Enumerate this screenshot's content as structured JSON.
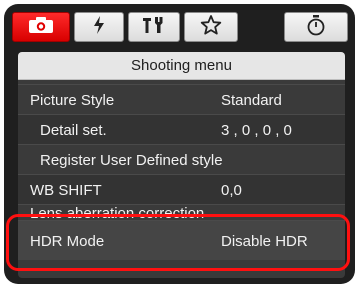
{
  "tabs": [
    {
      "icon": "camera-icon",
      "active": true
    },
    {
      "icon": "flash-icon",
      "active": false
    },
    {
      "icon": "tools-icon",
      "active": false
    },
    {
      "icon": "star-icon",
      "active": false
    },
    {
      "icon": "timer-icon",
      "active": false
    }
  ],
  "menu": {
    "title": "Shooting menu",
    "items": [
      {
        "label": "Picture Style",
        "value": "Standard"
      },
      {
        "label": "Detail set.",
        "value": "3 , 0 , 0 , 0"
      },
      {
        "label": "Register User Defined style",
        "value": ""
      },
      {
        "label": "WB SHIFT",
        "value": "0,0"
      },
      {
        "label": "Lens aberration correction",
        "value": ""
      },
      {
        "label": "HDR Mode",
        "value": "Disable HDR"
      }
    ]
  },
  "colors": {
    "active_tab": "#e00000",
    "highlight": "#ff1010",
    "panel_bg": "#3a3a3a"
  }
}
